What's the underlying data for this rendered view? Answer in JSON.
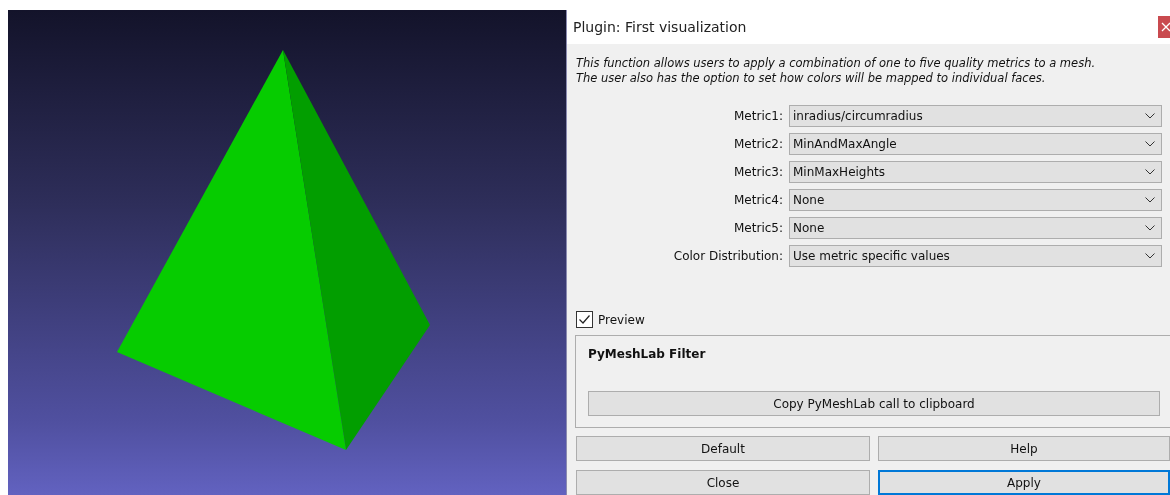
{
  "viewport": {
    "kind": "mesh"
  },
  "dialog": {
    "title": "Plugin: First visualization",
    "description": [
      "This function allows users to apply a combination of one to five quality metrics to a mesh.",
      "The user also has the option to set how colors will be mapped to individual faces."
    ],
    "fields": [
      {
        "label": "Metric1:",
        "value": "inradius/circumradius"
      },
      {
        "label": "Metric2:",
        "value": "MinAndMaxAngle"
      },
      {
        "label": "Metric3:",
        "value": "MinMaxHeights"
      },
      {
        "label": "Metric4:",
        "value": "None"
      },
      {
        "label": "Metric5:",
        "value": "None"
      },
      {
        "label": "Color Distribution:",
        "value": "Use metric specific values"
      }
    ],
    "preview": {
      "label": "Preview",
      "checked": true
    },
    "group": {
      "title": "PyMeshLab Filter",
      "button": "Copy PyMeshLab call to clipboard"
    },
    "buttons": [
      {
        "label": "Default",
        "focused": false
      },
      {
        "label": "Help",
        "focused": false
      },
      {
        "label": "Close",
        "focused": false
      },
      {
        "label": "Apply",
        "focused": true
      }
    ]
  }
}
